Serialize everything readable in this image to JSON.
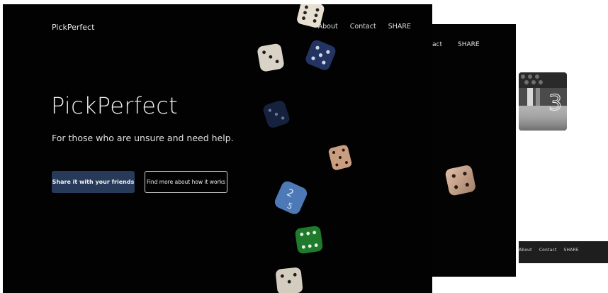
{
  "main": {
    "brand": "PickPerfect",
    "nav": [
      "About",
      "Contact",
      "SHARE"
    ],
    "hero": {
      "title": "PickPerfect",
      "subtitle": "For those who are unsure and need help."
    },
    "buttons": {
      "primary": "Share it with your friends",
      "secondary": "Find more about how it works"
    }
  },
  "mid_window": {
    "nav": [
      "act",
      "SHARE"
    ]
  },
  "back_window": {
    "nav": [
      "About",
      "Contact",
      "SHARE"
    ]
  },
  "thumbnail": {
    "number": "3"
  },
  "colors": {
    "background": "#020202",
    "primary_button": "#283a5a",
    "text": "#e8e8e8"
  }
}
